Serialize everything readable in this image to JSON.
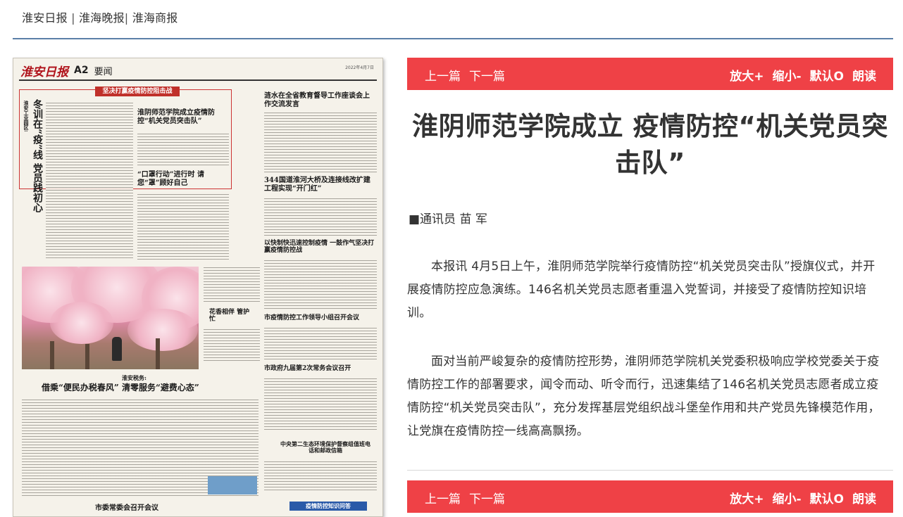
{
  "header": {
    "links": [
      "淮安日报",
      "淮海晚报",
      "淮海商报"
    ],
    "separators": [
      " | ",
      "| "
    ]
  },
  "newspaper": {
    "masthead": "淮安日报",
    "page": "A2",
    "section": "要闻",
    "date": "2022年4月7日",
    "banner": "坚决打赢疫情防控阻击战",
    "lead_title": "冬训在“疫”线 党员践初心",
    "lead_kicker": "淮安工业园区:",
    "headline_1": "淮阴师范学院成立疫情防控“机关党员突击队”",
    "headline_2": "“口罩行动”进行时 请您“罩”顾好自己",
    "headline_3": "涟水在全省教育督导工作座谈会上作交流发言",
    "headline_4": "344国道淮河大桥及连接线改扩建工程实现“开门红”",
    "headline_5": "以快制快迅速控制疫情 一鼓作气坚决打赢疫情防控战",
    "headline_6": "市疫情防控工作领导小组召开会议",
    "headline_7": "市政府九届第2次常务会议召开",
    "photo_caption": "花香相伴 管护忙",
    "headline_8_kicker": "淮安税务:",
    "headline_8": "借乘“便民办税春风” 清零服务“避费心态”",
    "headline_9": "中央第二生态环境保护督察组值班电话和邮政信箱",
    "headline_10": "市委常委会召开会议",
    "bottom_banner": "疫情防控知识问答"
  },
  "toolbar": {
    "prev": "上一篇",
    "next": "下一篇",
    "zoom_in": "放大+",
    "zoom_out": "缩小-",
    "reset": "默认O",
    "read": "朗读"
  },
  "article": {
    "title": "淮阴师范学院成立 疫情防控“机关党员突击队”",
    "author": "■通讯员 苗 军",
    "paragraphs": [
      "本报讯 4月5日上午，淮阴师范学院举行疫情防控“机关党员突击队”授旗仪式，并开展疫情防控应急演练。146名机关党员志愿者重温入党誓词，并接受了疫情防控知识培训。",
      "面对当前严峻复杂的疫情防控形势，淮阴师范学院机关党委积极响应学校党委关于疫情防控工作的部署要求，闻令而动、听令而行，迅速集结了146名机关党员志愿者成立疫情防控“机关党员突击队”，充分发挥基层党组织战斗堡垒作用和共产党员先锋模范作用，让党旗在疫情防控一线高高飘扬。"
    ]
  },
  "colors": {
    "toolbar_bg": "#ef4146",
    "divider": "#5b7fa8",
    "masthead": "#b0141c"
  }
}
